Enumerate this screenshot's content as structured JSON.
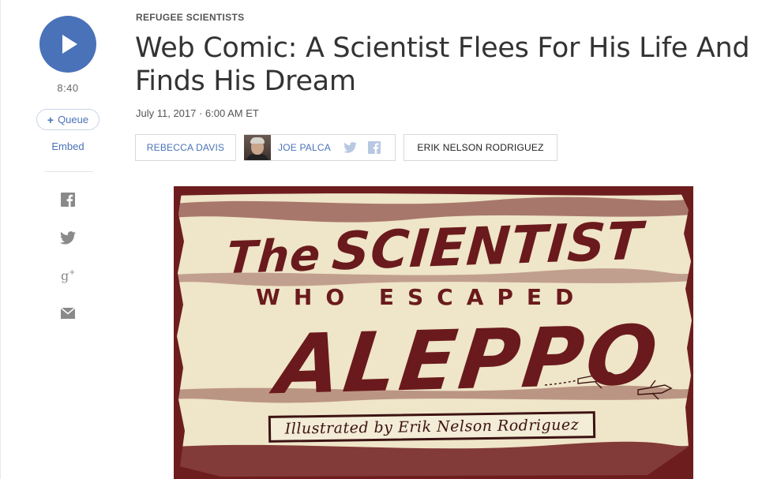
{
  "player": {
    "duration": "8:40",
    "queue_label": "Queue",
    "queue_plus": "+",
    "embed_label": "Embed"
  },
  "share": {
    "icons": [
      "facebook-icon",
      "twitter-icon",
      "google-plus-icon",
      "email-icon"
    ]
  },
  "article": {
    "eyebrow": "REFUGEE SCIENTISTS",
    "headline": "Web Comic: A Scientist Flees For His Life And Finds His Dream",
    "dateline": "July 11, 2017 · 6:00 AM ET"
  },
  "bylines": [
    {
      "name": "REBECCA DAVIS",
      "linked": true
    },
    {
      "name": "JOE PALCA",
      "linked": true,
      "has_photo": true,
      "social": [
        "twitter-icon",
        "facebook-icon"
      ]
    },
    {
      "name": "ERIK NELSON RODRIGUEZ",
      "linked": false
    }
  ],
  "comic": {
    "title_the": "The",
    "title_main": "SCIENTIST",
    "subtitle": "WHO ESCAPED",
    "city": "ALEPPO",
    "credit": "Illustrated by Erik Nelson Rodriguez"
  },
  "colors": {
    "accent": "#4a72b8",
    "comic_maroon": "#6e1d1f",
    "comic_cream": "#efe5c9",
    "text": "#333333"
  }
}
